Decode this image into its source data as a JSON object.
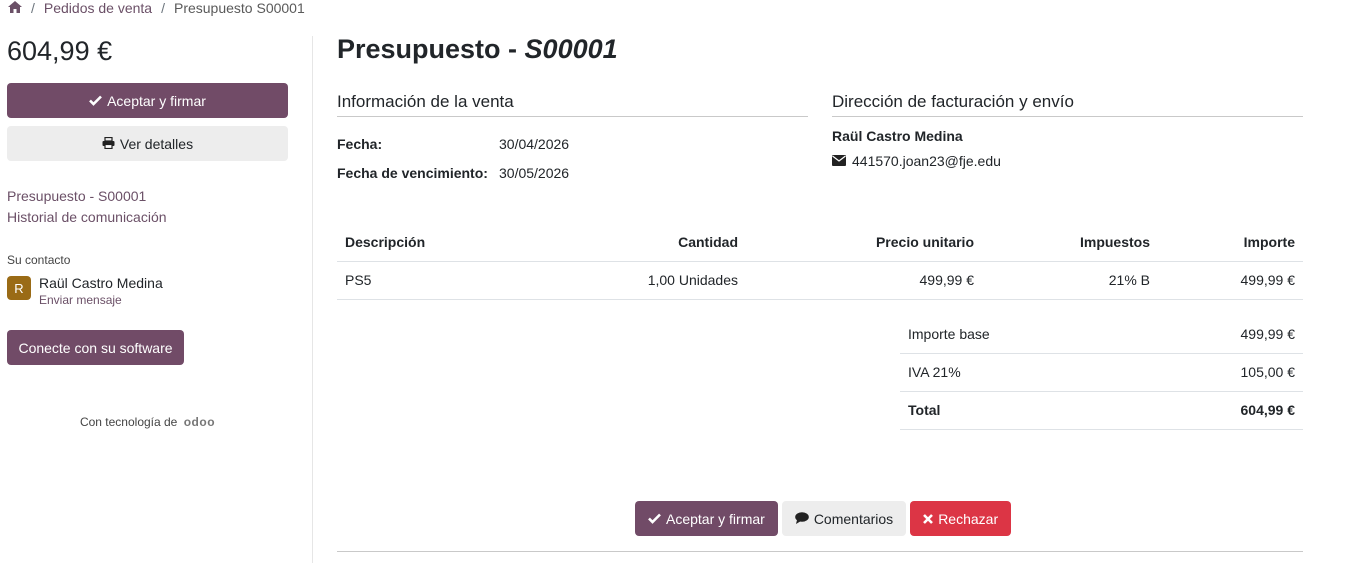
{
  "breadcrumb": {
    "home_icon": "home-icon",
    "items": [
      "Pedidos de venta",
      "Presupuesto S00001"
    ]
  },
  "sidebar": {
    "amount": "604,99 €",
    "accept_label": "Aceptar y firmar",
    "details_label": "Ver detalles",
    "links": [
      "Presupuesto - S00001",
      "Historial de comunicación"
    ],
    "contact_heading": "Su contacto",
    "contact_initial": "R",
    "contact_name": "Raül Castro Medina",
    "contact_message": "Enviar mensaje",
    "connect_label": "Conecte con su software",
    "powered_prefix": "Con tecnología de",
    "powered_brand": "odoo"
  },
  "main": {
    "title_prefix": "Presupuesto - ",
    "title_ref": "S00001",
    "sale_info": {
      "heading": "Información de la venta",
      "date_label": "Fecha:",
      "date_value": "30/04/2026",
      "expiry_label": "Fecha de vencimiento:",
      "expiry_value": "30/05/2026"
    },
    "address": {
      "heading": "Dirección de facturación y envío",
      "name": "Raül Castro Medina",
      "email": "441570.joan23@fje.edu"
    },
    "lines": {
      "headers": [
        "Descripción",
        "Cantidad",
        "Precio unitario",
        "Impuestos",
        "Importe"
      ],
      "rows": [
        [
          "PS5",
          "1,00 Unidades",
          "499,99 €",
          "21% B",
          "499,99 €"
        ]
      ]
    },
    "totals": [
      {
        "label": "Importe base",
        "value": "499,99 €"
      },
      {
        "label": "IVA 21%",
        "value": "105,00 €"
      },
      {
        "label": "Total",
        "value": "604,99 €"
      }
    ],
    "actions": {
      "accept_label": "Aceptar y firmar",
      "comments_label": "Comentarios",
      "reject_label": "Rechazar"
    }
  },
  "colors": {
    "primary": "#714b67",
    "danger": "#dc3545",
    "avatar": "#9a6b16"
  }
}
